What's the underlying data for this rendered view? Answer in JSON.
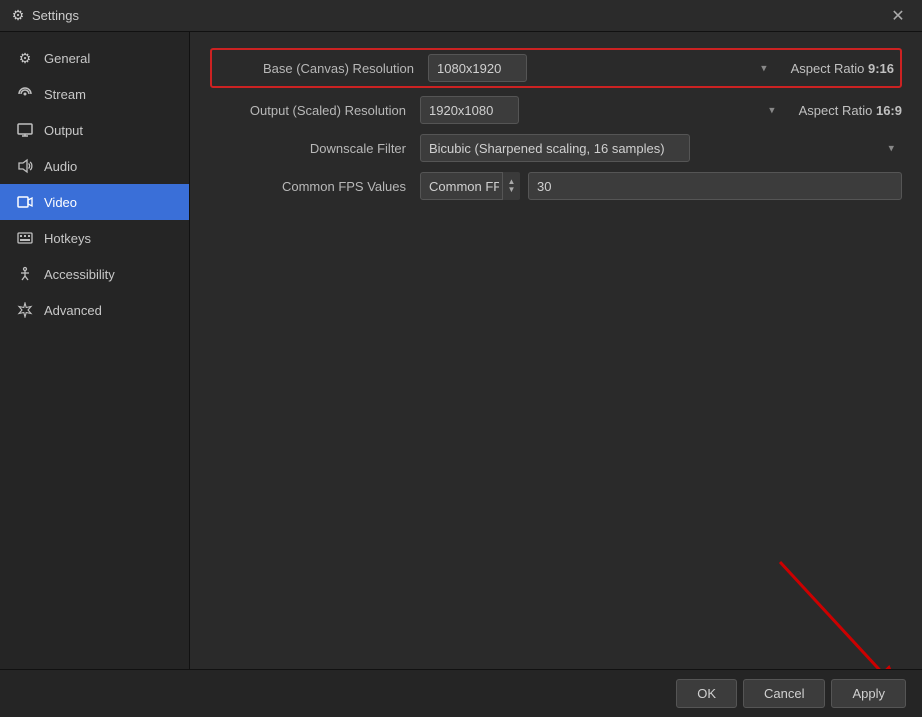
{
  "titleBar": {
    "title": "Settings",
    "closeLabel": "✕"
  },
  "sidebar": {
    "items": [
      {
        "id": "general",
        "label": "General",
        "icon": "⚙",
        "active": false
      },
      {
        "id": "stream",
        "label": "Stream",
        "icon": "📡",
        "active": false
      },
      {
        "id": "output",
        "label": "Output",
        "icon": "📤",
        "active": false
      },
      {
        "id": "audio",
        "label": "Audio",
        "icon": "🔊",
        "active": false
      },
      {
        "id": "video",
        "label": "Video",
        "icon": "🖥",
        "active": true
      },
      {
        "id": "hotkeys",
        "label": "Hotkeys",
        "icon": "⌨",
        "active": false
      },
      {
        "id": "accessibility",
        "label": "Accessibility",
        "icon": "♿",
        "active": false
      },
      {
        "id": "advanced",
        "label": "Advanced",
        "icon": "✦",
        "active": false
      }
    ]
  },
  "content": {
    "rows": [
      {
        "id": "base-resolution",
        "label": "Base (Canvas) Resolution",
        "value": "1080x1920",
        "aspectLabel": "Aspect Ratio",
        "aspectValue": "9:16",
        "highlighted": true
      },
      {
        "id": "output-resolution",
        "label": "Output (Scaled) Resolution",
        "value": "1920x1080",
        "aspectLabel": "Aspect Ratio",
        "aspectValue": "16:9",
        "highlighted": false
      },
      {
        "id": "downscale-filter",
        "label": "Downscale Filter",
        "value": "Bicubic (Sharpened scaling, 16 samples)",
        "highlighted": false
      },
      {
        "id": "fps",
        "label": "Common FPS Values",
        "fpsValue": "30",
        "highlighted": false
      }
    ]
  },
  "buttons": {
    "ok": "OK",
    "cancel": "Cancel",
    "apply": "Apply"
  }
}
